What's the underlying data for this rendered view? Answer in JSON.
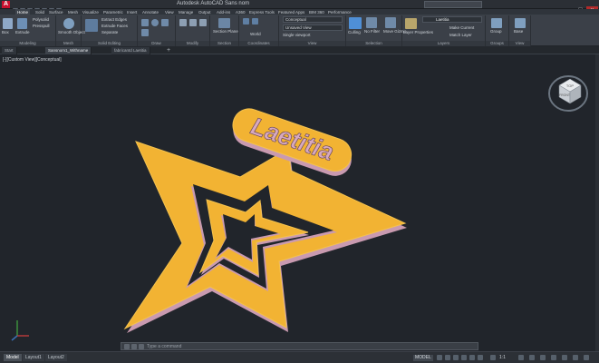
{
  "title": {
    "app_name": "Autodesk AutoCAD",
    "document": "Sans nom"
  },
  "ribbon_tabs": [
    "Home",
    "Solid",
    "Surface",
    "Mesh",
    "Visualize",
    "Parametric",
    "Insert",
    "Annotate",
    "View",
    "Manage",
    "Output",
    "Add-ins",
    "A360",
    "Express Tools",
    "Featured Apps",
    "BIM 360",
    "Performance"
  ],
  "ribbon_panels": {
    "modeling": "Modeling",
    "mesh": "Mesh",
    "solid_editing": "Solid Editing",
    "draw": "Draw",
    "modify": "Modify",
    "section": "Section",
    "coordinates": "Coordinates",
    "view": "View",
    "selection": "Selection",
    "layers": "Layers",
    "groups": "Groups",
    "view2": "View"
  },
  "ribbon_buttons": {
    "box": "Box",
    "extrude": "Extrude",
    "polysolid": "Polysolid",
    "presspull": "Presspull",
    "smooth_object": "Smooth Object",
    "extract_edges": "Extract Edges",
    "extrude_faces": "Extrude Faces",
    "separate": "Separate",
    "section_plane": "Section Plane",
    "world": "World",
    "conceptual": "Conceptual",
    "unsaved_view": "Unsaved View",
    "single_viewport": "Single viewport",
    "culling": "Culling",
    "no_filter": "No Filter",
    "move_gizmo": "Move Gizmo",
    "layer_properties": "Layer Properties",
    "layer_name": "Laetitia",
    "make_current": "Make Current",
    "match_layer": "Match Layer",
    "group": "Group",
    "base": "Base"
  },
  "file_tabs": [
    "Start",
    "Sansnom1_Withname",
    "fabricantd Laetitia"
  ],
  "viewport": {
    "label": "[-][Custom View][Conceptual]",
    "model_text": "Laetitia",
    "viewcube_top": "TOP",
    "viewcube_front": "FRONT"
  },
  "command": {
    "placeholder": "Type a command"
  },
  "layout_tabs": [
    "Model",
    "Layout1",
    "Layout2"
  ],
  "status": {
    "model": "MODEL",
    "scale": "1:1"
  },
  "colors": {
    "accent_star": "#f2b333",
    "star_side": "#c99ab0",
    "ribbon_bg": "#3b4048",
    "viewport_bg": "#21252b",
    "logo_red": "#c8102e"
  }
}
